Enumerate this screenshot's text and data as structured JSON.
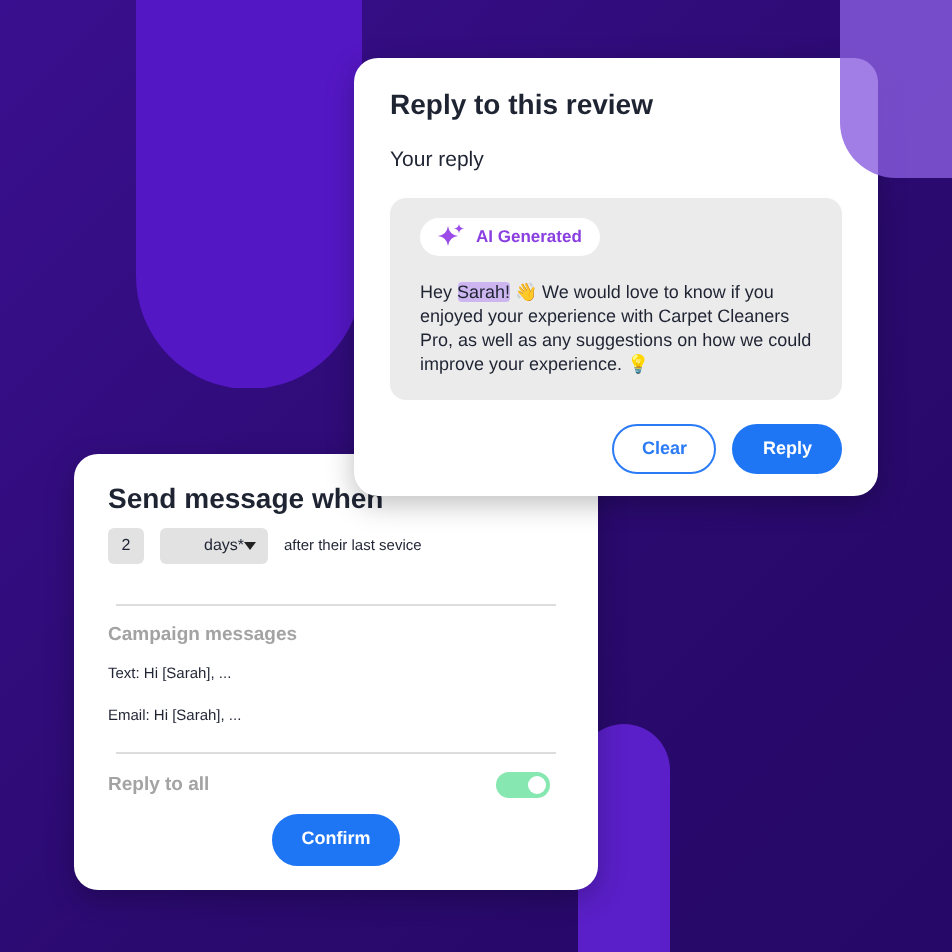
{
  "reply_card": {
    "title": "Reply to this review",
    "label": "Your reply",
    "ai_badge": "AI Generated",
    "greeting": "Hey",
    "name": "Sarah!",
    "body": "👋 We would love to know if you enjoyed your experience with Carpet Cleaners Pro, as well as any suggestions on how we could improve your experience. 💡",
    "buttons": [
      {
        "label": "Clear",
        "kind": "outline"
      },
      {
        "label": "Reply",
        "kind": "primary"
      }
    ]
  },
  "send_card": {
    "title": "Send message when",
    "count": "2",
    "unit": "days*",
    "after": "after their last sevice",
    "campaign_title": "Campaign messages",
    "messages": [
      "Text: Hi [Sarah], ...",
      "Email: Hi [Sarah], ..."
    ],
    "reply_all": {
      "label": "Reply to all",
      "on": true
    },
    "confirm": "Confirm"
  }
}
